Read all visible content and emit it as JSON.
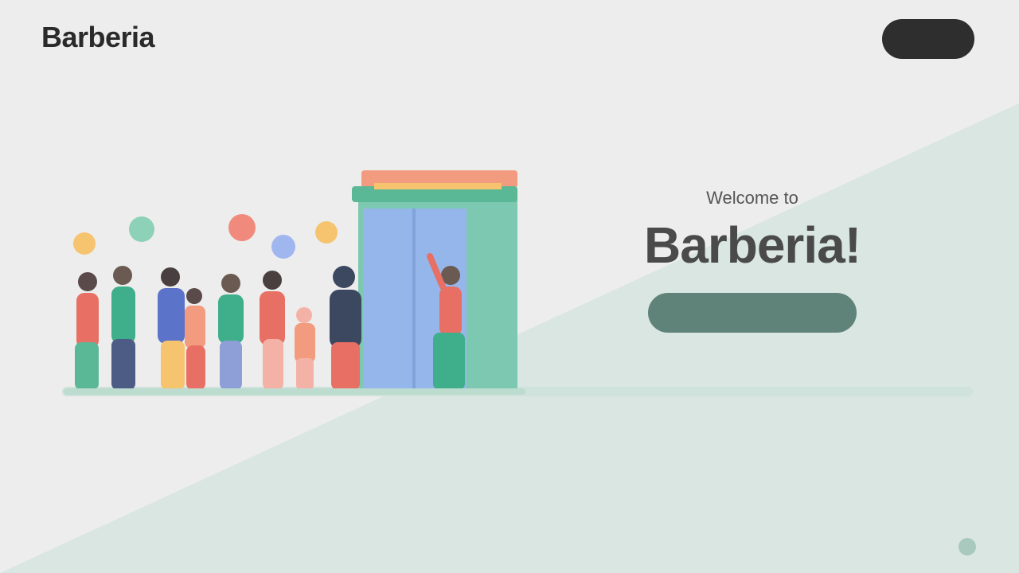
{
  "header": {
    "brand": "Barberia",
    "action_button_label": ""
  },
  "hero": {
    "eyebrow": "Welcome to",
    "headline": "Barberia!",
    "cta_label": ""
  },
  "footnote": {
    "line1": "",
    "line2": ""
  },
  "corner_link": {
    "label": "",
    "icon": "arrow-icon"
  },
  "colors": {
    "page_bg": "#ededed",
    "wedge": "#d9e6e2",
    "cta": "#5f8279",
    "header_button": "#2e2e2e",
    "awning_top": "#f29b7e",
    "awning_bottom": "#5ab896",
    "door": "#94b6ea",
    "wall": "#7dc8b0"
  }
}
